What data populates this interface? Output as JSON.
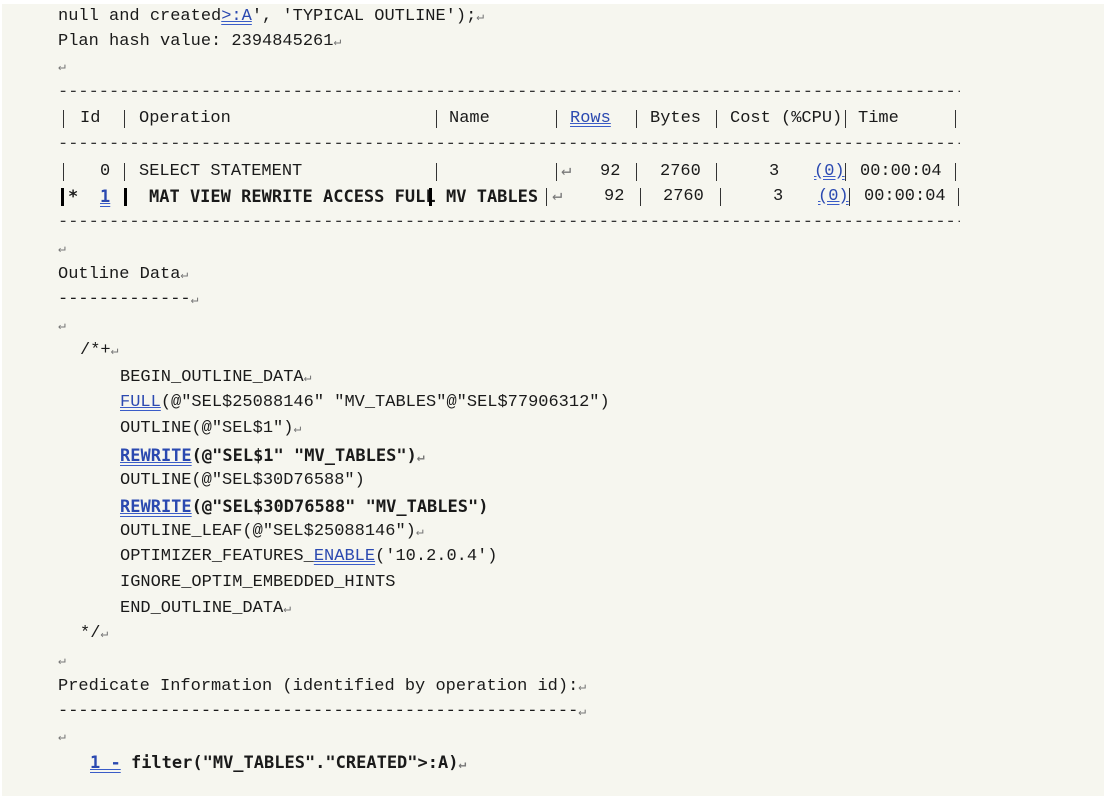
{
  "header": {
    "line1_prefix": "null and created",
    "line1_underlined": ">:A",
    "line1_suffix": "', 'TYPICAL OUTLINE');",
    "plan_hash": "Plan hash value: 2394845261"
  },
  "plan_table": {
    "columns": [
      "Id",
      "Operation",
      "Name",
      "Rows",
      "Bytes",
      "Cost (%CPU)",
      "Time"
    ],
    "rows": [
      {
        "marker": "",
        "id": "0",
        "operation": "SELECT STATEMENT",
        "name": "",
        "rows": "92",
        "bytes": "2760",
        "cost": "3",
        "cpu": "(0)",
        "time": "00:00:04"
      },
      {
        "marker": "*",
        "id": "1",
        "operation": "MAT VIEW REWRITE ACCESS FULL",
        "name": "MV TABLES",
        "rows": "92",
        "bytes": "2760",
        "cost": "3",
        "cpu": "(0)",
        "time": "00:00:04"
      }
    ]
  },
  "outline": {
    "title": "Outline Data",
    "underline": "-------------",
    "open": "/*+",
    "begin": "BEGIN_OUTLINE_DATA",
    "full_kw": "FULL",
    "full_args": "(@\"SEL$25088146\" \"MV_TABLES\"@\"SEL$77906312\")",
    "outline1": "OUTLINE(@\"SEL$1\")",
    "rewrite1_kw": "REWRITE",
    "rewrite1_args": "(@\"SEL$1\" \"MV_TABLES\")",
    "outline2": "OUTLINE(@\"SEL$30D76588\")",
    "rewrite2_kw": "REWRITE",
    "rewrite2_args": "(@\"SEL$30D76588\" \"MV_TABLES\")",
    "outline_leaf": "OUTLINE_LEAF(@\"SEL$25088146\")",
    "opt_prefix": "OPTIMIZER_FEATURES_",
    "opt_kw": "ENABLE",
    "opt_args": "('10.2.0.4')",
    "ignore": "IGNORE_OPTIM_EMBEDDED_HINTS",
    "end": "END_OUTLINE_DATA",
    "close": "*/"
  },
  "predicate": {
    "title": "Predicate Information (identified by operation id):",
    "underline": "---------------------------------------------------",
    "id_label": "1 -",
    "filter": " filter(\"MV_TABLES\".\"CREATED\">:A)"
  },
  "symbols": {
    "paragraph_mark": "↵",
    "dash_rule": "--------------------------------------------------------------------------------------------------------------"
  },
  "colors": {
    "page_bg": "#f6f6ef",
    "squiggle": "#3a5cc8"
  }
}
